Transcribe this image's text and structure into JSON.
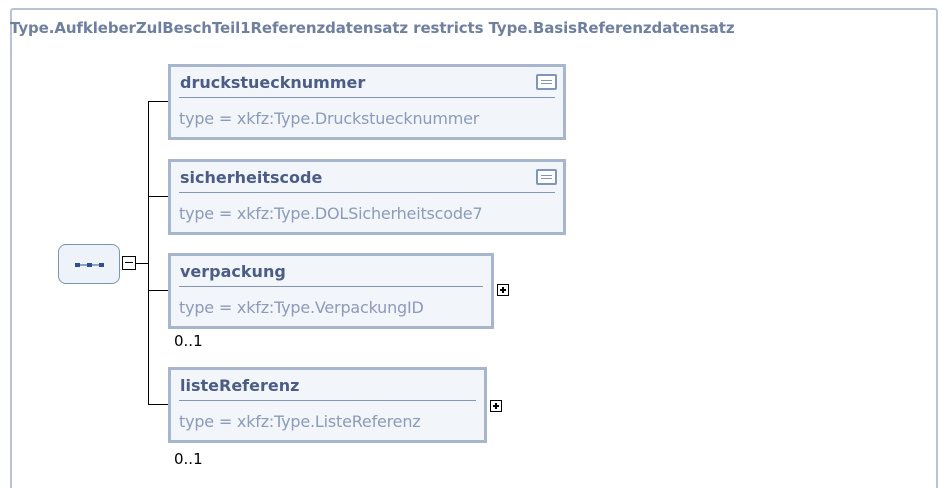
{
  "complex_type": {
    "title": "Type.AufkleberZulBeschTeil1Referenzdatensatz restricts Type.BasisReferenzdatensatz"
  },
  "compositor": {
    "kind": "sequence"
  },
  "elements": [
    {
      "name": "druckstuecknummer",
      "type": "type = xkfz:Type.Druckstuecknummer",
      "has_documentation": true,
      "expandable": false,
      "occurs": ""
    },
    {
      "name": "sicherheitscode",
      "type": "type = xkfz:Type.DOLSicherheitscode7",
      "has_documentation": true,
      "expandable": false,
      "occurs": ""
    },
    {
      "name": "verpackung",
      "type": "type = xkfz:Type.VerpackungID",
      "has_documentation": false,
      "expandable": true,
      "occurs": "0..1"
    },
    {
      "name": "listeReferenz",
      "type": "type = xkfz:Type.ListeReferenz",
      "has_documentation": false,
      "expandable": true,
      "occurs": "0..1"
    }
  ],
  "colors": {
    "border": "#a8b6cd",
    "name": "#4b5d86",
    "type": "#8c9abb",
    "title": "#6f7f9f"
  }
}
